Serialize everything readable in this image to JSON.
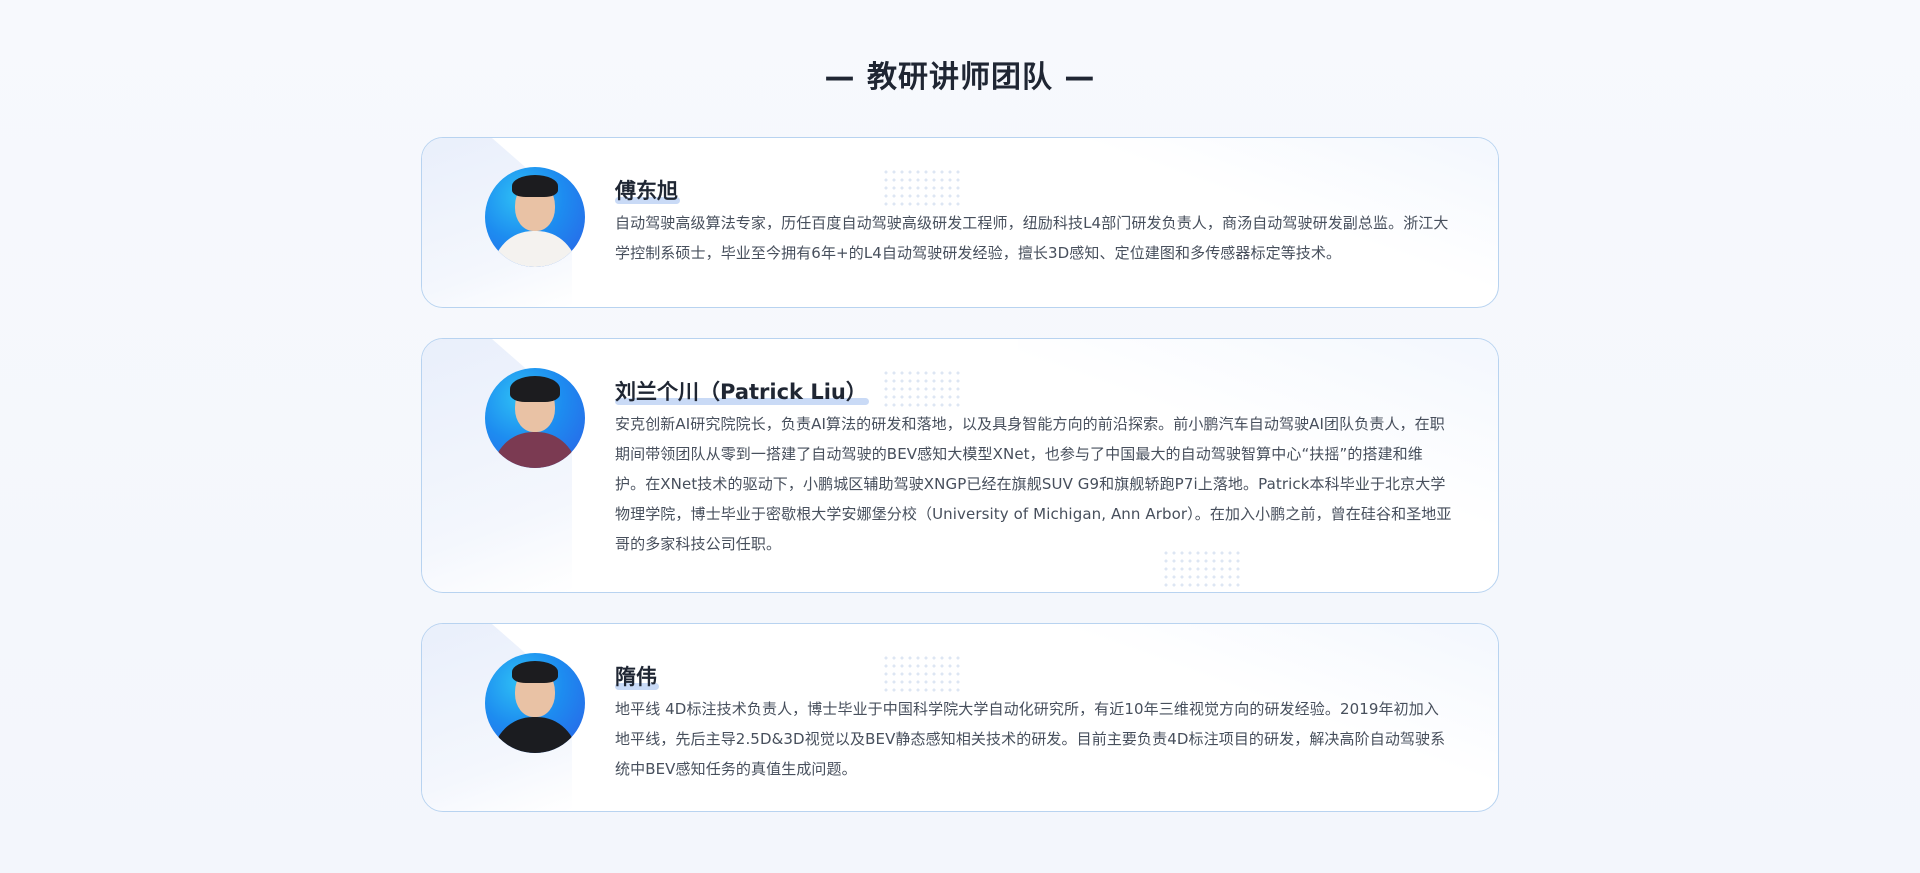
{
  "page": {
    "title": "— 教研讲师团队 —"
  },
  "colors": {
    "card_border": "#b8d3f0",
    "avatar_blue": "#1d8cf0",
    "name_highlight": "#c9daf6",
    "text_primary": "#1f2633",
    "text_secondary": "#474f5c"
  },
  "instructors": [
    {
      "name": "傅东旭",
      "bio": "自动驾驶高级算法专家，历任百度自动驾驶高级研发工程师，纽励科技L4部门研发负责人，商汤自动驾驶研发副总监。浙江大学控制系硕士，毕业至今拥有6年+的L4自动驾驶研发经验，擅长3D感知、定位建图和多传感器标定等技术。"
    },
    {
      "name": "刘兰个川（Patrick Liu）",
      "bio": "安克创新AI研究院院长，负责AI算法的研发和落地，以及具身智能方向的前沿探索。前小鹏汽车自动驾驶AI团队负责人，在职期间带领团队从零到一搭建了自动驾驶的BEV感知大模型XNet，也参与了中国最大的自动驾驶智算中心“扶摇”的搭建和维护。在XNet技术的驱动下，小鹏城区辅助驾驶XNGP已经在旗舰SUV G9和旗舰轿跑P7i上落地。Patrick本科毕业于北京大学物理学院，博士毕业于密歇根大学安娜堡分校（University of Michigan, Ann Arbor）。在加入小鹏之前，曾在硅谷和圣地亚哥的多家科技公司任职。"
    },
    {
      "name": "隋伟",
      "bio": "地平线 4D标注技术负责人，博士毕业于中国科学院大学自动化研究所，有近10年三维视觉方向的研发经验。2019年初加入地平线，先后主导2.5D&3D视觉以及BEV静态感知相关技术的研发。目前主要负责4D标注项目的研发，解决高阶自动驾驶系统中BEV感知任务的真值生成问题。"
    }
  ]
}
